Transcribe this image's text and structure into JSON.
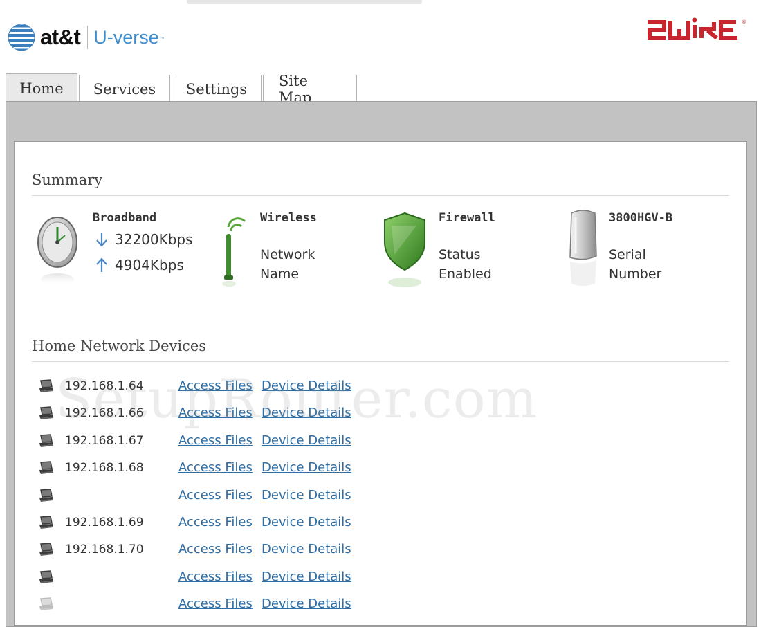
{
  "header": {
    "att_logo": "at&t",
    "uverse_logo": "U-verse",
    "trademark": "™",
    "brand_logo": "2WIRE"
  },
  "tabs": [
    {
      "label": "Home",
      "active": true
    },
    {
      "label": "Services",
      "active": false
    },
    {
      "label": "Settings",
      "active": false
    },
    {
      "label": "Site Map",
      "active": false
    }
  ],
  "summary": {
    "title": "Summary",
    "broadband": {
      "label": "Broadband",
      "download": "32200Kbps",
      "upload": "4904Kbps",
      "icon": "gauge-icon"
    },
    "wireless": {
      "label": "Wireless",
      "line1": "Network",
      "line2": "Name",
      "icon": "wireless-antenna-icon"
    },
    "firewall": {
      "label": "Firewall",
      "line1": "Status",
      "line2": "Enabled",
      "icon": "shield-icon"
    },
    "device": {
      "label": "3800HGV-B",
      "line1": "Serial",
      "line2": "Number",
      "icon": "gateway-device-icon"
    }
  },
  "devices": {
    "title": "Home Network Devices",
    "access_label": "Access Files",
    "details_label": "Device Details",
    "rows": [
      {
        "ip": "192.168.1.64",
        "active": true
      },
      {
        "ip": "192.168.1.66",
        "active": true
      },
      {
        "ip": "192.168.1.67",
        "active": true
      },
      {
        "ip": "192.168.1.68",
        "active": true
      },
      {
        "ip": "",
        "active": true
      },
      {
        "ip": "192.168.1.69",
        "active": true
      },
      {
        "ip": "192.168.1.70",
        "active": true
      },
      {
        "ip": "",
        "active": true
      },
      {
        "ip": "",
        "active": false
      }
    ]
  },
  "watermark": "SetupRouter.com",
  "colors": {
    "uverse_blue": "#3d8fd0",
    "brand_red": "#c8252f",
    "link_blue": "#2f6ea5",
    "frame_grey": "#c2c2c2",
    "shield_green": "#4e9a2c"
  }
}
